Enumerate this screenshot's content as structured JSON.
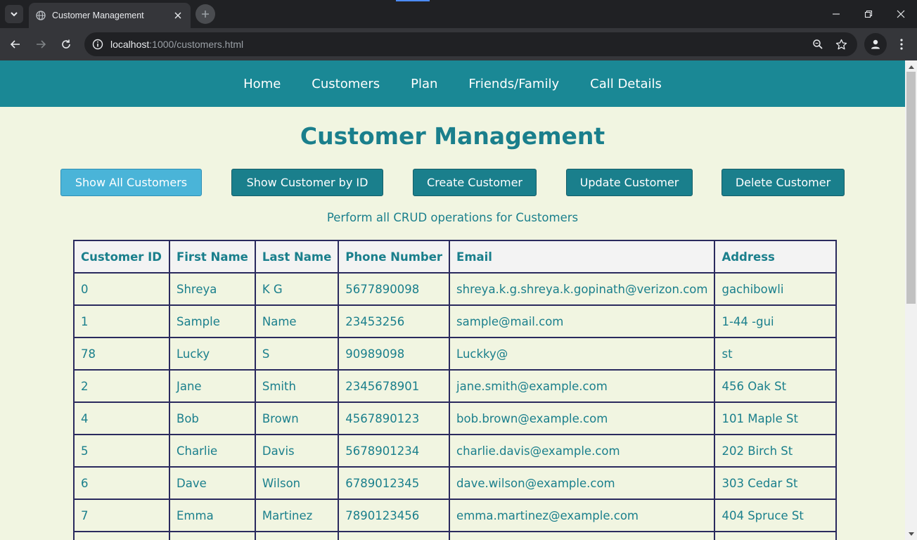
{
  "browser": {
    "tab_title": "Customer Management",
    "url_host": "localhost",
    "url_path": ":1000/customers.html"
  },
  "nav": {
    "items": [
      "Home",
      "Customers",
      "Plan",
      "Friends/Family",
      "Call Details"
    ]
  },
  "page": {
    "title": "Customer Management",
    "subtitle": "Perform all CRUD operations for Customers"
  },
  "actions": {
    "show_all": "Show All Customers",
    "show_by_id": "Show Customer by ID",
    "create": "Create Customer",
    "update": "Update Customer",
    "delete": "Delete Customer"
  },
  "table": {
    "headers": [
      "Customer ID",
      "First Name",
      "Last Name",
      "Phone Number",
      "Email",
      "Address"
    ],
    "rows": [
      [
        "0",
        "Shreya",
        "K G",
        "5677890098",
        "shreya.k.g.shreya.k.gopinath@verizon.com",
        "gachibowli"
      ],
      [
        "1",
        "Sample",
        "Name",
        "23453256",
        "sample@mail.com",
        "1-44 -gui"
      ],
      [
        "78",
        "Lucky",
        "S",
        "90989098",
        "Luckky@",
        "st"
      ],
      [
        "2",
        "Jane",
        "Smith",
        "2345678901",
        "jane.smith@example.com",
        "456 Oak St"
      ],
      [
        "4",
        "Bob",
        "Brown",
        "4567890123",
        "bob.brown@example.com",
        "101 Maple St"
      ],
      [
        "5",
        "Charlie",
        "Davis",
        "5678901234",
        "charlie.davis@example.com",
        "202 Birch St"
      ],
      [
        "6",
        "Dave",
        "Wilson",
        "6789012345",
        "dave.wilson@example.com",
        "303 Cedar St"
      ],
      [
        "7",
        "Emma",
        "Martinez",
        "7890123456",
        "emma.martinez@example.com",
        "404 Spruce St"
      ],
      [
        "",
        "",
        "",
        "",
        "",
        ""
      ]
    ]
  },
  "colors": {
    "nav_bg": "#1a8895",
    "page_bg": "#f1f5e1",
    "accent": "#1a7f8c",
    "active_button": "#4ab4d8",
    "table_border": "#2a2a5e"
  }
}
